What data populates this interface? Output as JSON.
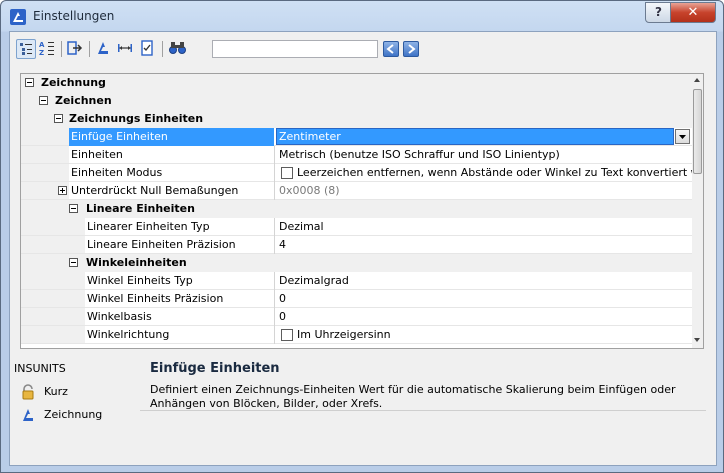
{
  "window": {
    "title": "Einstellungen",
    "help_label": "?",
    "close_label": "✕"
  },
  "toolbar": {
    "icons": [
      "category-view-icon",
      "alpha-sort-icon",
      "export-icon",
      "units-icon",
      "dimension-icon",
      "checklist-icon",
      "find-icon"
    ],
    "search": {
      "value": "",
      "placeholder": ""
    }
  },
  "grid": {
    "rows": [
      {
        "kind": "category",
        "level": 0,
        "label": "Zeichnung"
      },
      {
        "kind": "category",
        "level": 1,
        "label": "Zeichnen"
      },
      {
        "kind": "category",
        "level": 2,
        "label": "Zeichnungs Einheiten"
      },
      {
        "kind": "property",
        "name": "Einfüge Einheiten",
        "value": "Zentimeter",
        "selected": true
      },
      {
        "kind": "property",
        "name": "Einheiten",
        "value": "Metrisch (benutze ISO Schraffur und ISO Linientyp)"
      },
      {
        "kind": "property",
        "name": "Einheiten Modus",
        "value": "Leerzeichen entfernen, wenn Abstände oder Winkel zu Text konvertiert werden",
        "checkbox": true
      },
      {
        "kind": "property",
        "name": "Unterdrückt Null Bemaßungen",
        "value": "0x0008 (8)",
        "expandable": true,
        "disabled": true
      },
      {
        "kind": "category",
        "level": 3,
        "label": "Lineare Einheiten"
      },
      {
        "kind": "property",
        "name": "Linearer Einheiten Typ",
        "value": "Dezimal"
      },
      {
        "kind": "property",
        "name": "Lineare Einheiten Präzision",
        "value": "4"
      },
      {
        "kind": "category",
        "level": 3,
        "label": "Winkeleinheiten"
      },
      {
        "kind": "property",
        "name": "Winkel Einheits Typ",
        "value": "Dezimalgrad"
      },
      {
        "kind": "property",
        "name": "Winkel Einheits Präzision",
        "value": "0"
      },
      {
        "kind": "property",
        "name": "Winkelbasis",
        "value": "0"
      },
      {
        "kind": "property",
        "name": "Winkelrichtung",
        "value": "Im Uhrzeigersinn",
        "checkbox": true
      }
    ]
  },
  "description": {
    "sysvar": "INSUNITS",
    "favorites": [
      {
        "icon": "lock-icon",
        "label": "Kurz"
      },
      {
        "icon": "drawing-icon",
        "label": "Zeichnung"
      }
    ],
    "title": "Einfüge Einheiten",
    "text": "Definiert einen Zeichnungs-Einheiten Wert für die automatische Skalierung beim Einfügen oder Anhängen von Blöcken, Bilder, oder Xrefs."
  }
}
